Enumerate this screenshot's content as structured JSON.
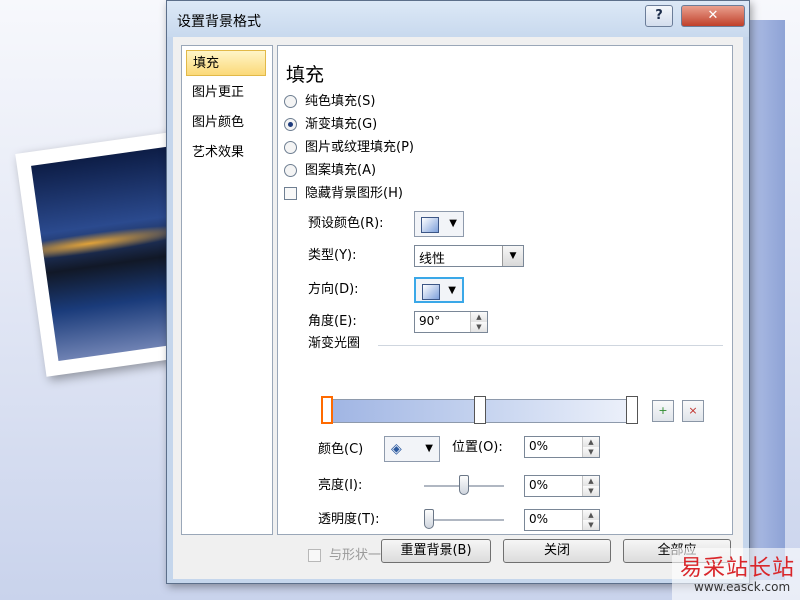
{
  "dialog": {
    "title": "设置背景格式",
    "help_glyph": "?",
    "close_glyph": "✕"
  },
  "nav": {
    "items": [
      {
        "label": "填充",
        "selected": true
      },
      {
        "label": "图片更正",
        "selected": false
      },
      {
        "label": "图片颜色",
        "selected": false
      },
      {
        "label": "艺术效果",
        "selected": false
      }
    ]
  },
  "fill": {
    "heading": "填充",
    "options": [
      {
        "label": "纯色填充(S)",
        "checked": false
      },
      {
        "label": "渐变填充(G)",
        "checked": true
      },
      {
        "label": "图片或纹理填充(P)",
        "checked": false
      },
      {
        "label": "图案填充(A)",
        "checked": false
      }
    ],
    "hide_bg_label": "隐藏背景图形(H)",
    "preset_label": "预设颜色(R):",
    "type_label": "类型(Y):",
    "type_value": "线性",
    "direction_label": "方向(D):",
    "angle_label": "角度(E):",
    "angle_value": "90°",
    "stops_label": "渐变光圈",
    "color_label": "颜色(C)",
    "position_label": "位置(O):",
    "position_value": "0%",
    "brightness_label": "亮度(I):",
    "brightness_value": "0%",
    "brightness_level": 0.5,
    "transparency_label": "透明度(T):",
    "transparency_value": "0%",
    "transparency_level": 0.0,
    "rotate_label": "与形状一起旋转(W)"
  },
  "buttons": {
    "reset": "重置背景(B)",
    "close": "关闭",
    "apply_all": "全部应"
  },
  "watermark": {
    "title": "易采站长站",
    "url": "www.easck.com"
  },
  "colors": {
    "accent_selection": "#fbd979",
    "stop_selected": "#ff6a00",
    "close_button": "#c0402a"
  }
}
